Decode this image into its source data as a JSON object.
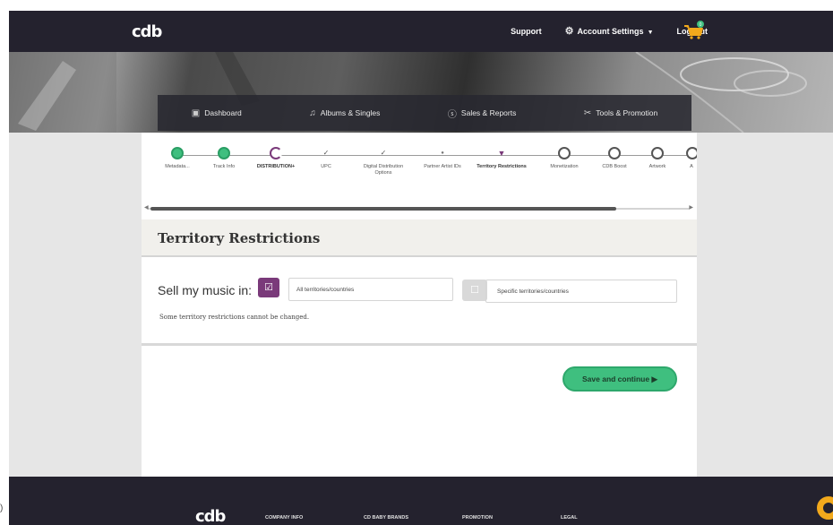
{
  "header": {
    "logo": "cdb",
    "links": {
      "support": "Support",
      "account_settings": "Account Settings",
      "logout": "Log Out"
    },
    "cart_badge": "0"
  },
  "nav": {
    "items": [
      {
        "icon": "dashboard-icon",
        "label": "Dashboard"
      },
      {
        "icon": "music-note-icon",
        "label": "Albums & Singles"
      },
      {
        "icon": "dollar-icon",
        "label": "Sales & Reports"
      },
      {
        "icon": "tools-icon",
        "label": "Tools & Promotion"
      }
    ]
  },
  "stepper": {
    "steps": [
      {
        "label": "Metadata...",
        "state": "done"
      },
      {
        "label": "Track Info",
        "state": "done"
      },
      {
        "label": "DISTRIBUTION+",
        "state": "current"
      },
      {
        "label": "UPC",
        "state": "tick"
      },
      {
        "label": "Digital Distribution Options",
        "state": "tick"
      },
      {
        "label": "Partner Artist IDs",
        "state": "small"
      },
      {
        "label": "Territory Restrictions",
        "state": "pin"
      },
      {
        "label": "Monetization",
        "state": "open"
      },
      {
        "label": "CDB Boost",
        "state": "open"
      },
      {
        "label": "Artwork",
        "state": "open"
      },
      {
        "label": "A",
        "state": "open"
      }
    ]
  },
  "section": {
    "title": "Territory Restrictions"
  },
  "territory": {
    "sell_label": "Sell my music in:",
    "option_all": "All territories/countries",
    "option_specific": "Specific territories/countries",
    "note": "Some territory restrictions cannot be changed."
  },
  "actions": {
    "save_continue": "Save and continue ▶"
  },
  "footer": {
    "logo": "cdb",
    "links": [
      "COMPANY INFO",
      "CD BABY BRANDS",
      "PROMOTION",
      "LEGAL"
    ]
  },
  "colors": {
    "accent_green": "#3fbf7f",
    "accent_purple": "#7a3a7a",
    "header_bg": "#24222e"
  }
}
